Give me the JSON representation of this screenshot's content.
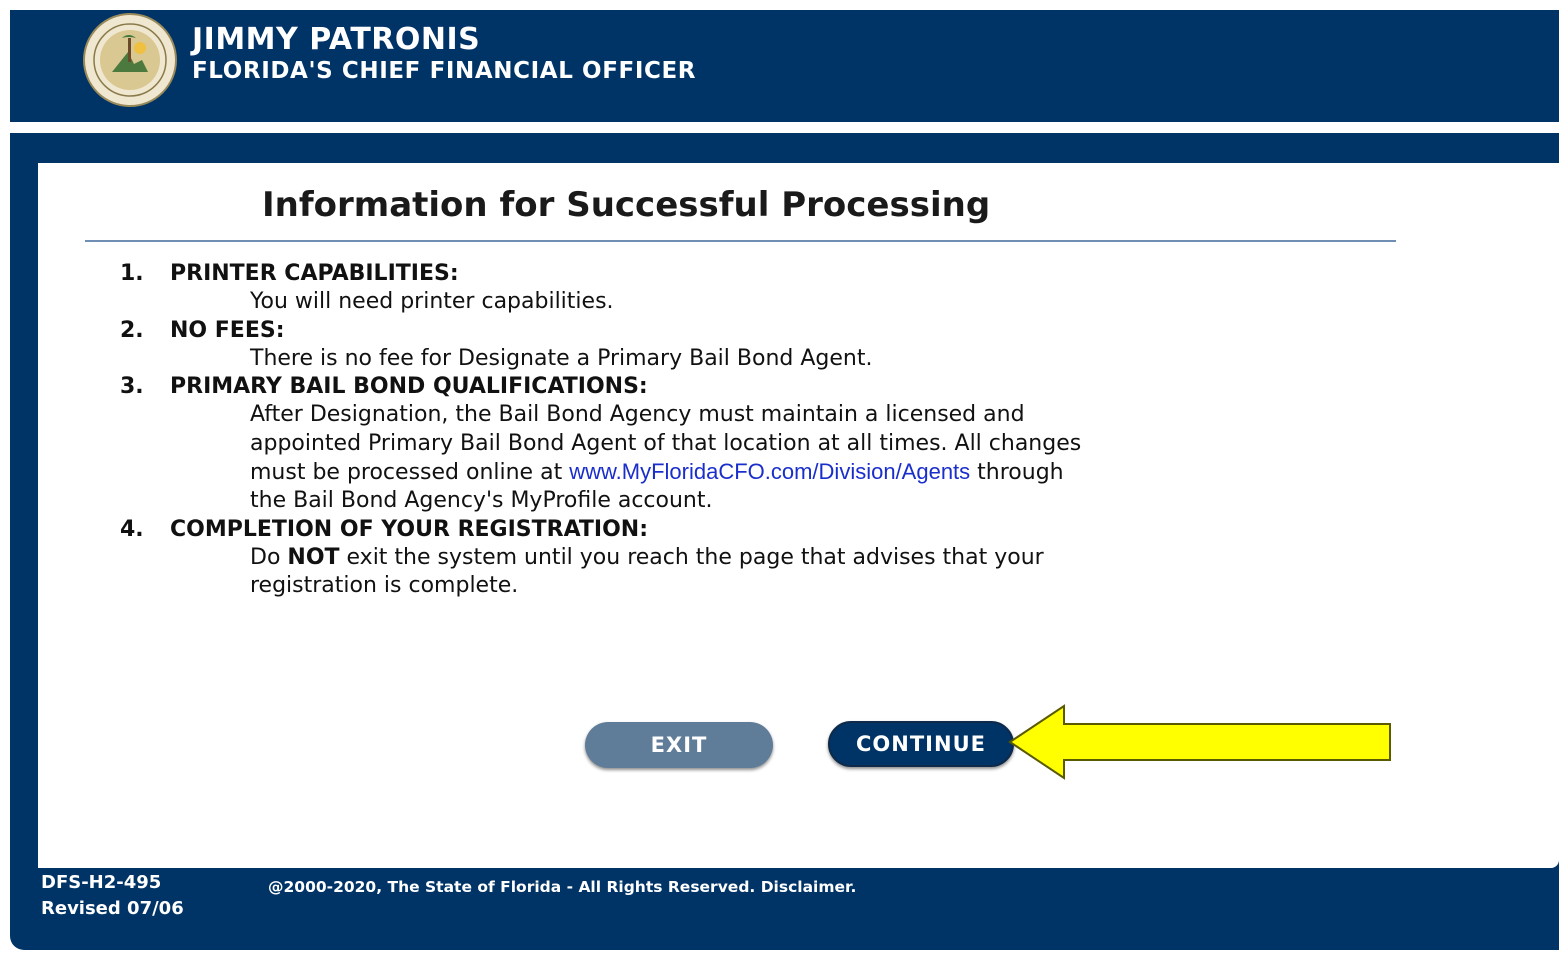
{
  "header": {
    "name": "JIMMY PATRONIS",
    "subtitle": "FLORIDA'S CHIEF FINANCIAL OFFICER",
    "seal_icon": "florida-cfo-seal-icon"
  },
  "main": {
    "title": "Information for Successful Processing",
    "items": [
      {
        "number": "1.",
        "heading": "PRINTER CAPABILITIES:",
        "body": "You will need printer capabilities."
      },
      {
        "number": "2.",
        "heading": "NO FEES:",
        "body": "There is no fee for Designate a Primary Bail Bond Agent."
      },
      {
        "number": "3.",
        "heading": "PRIMARY BAIL BOND QUALIFICATIONS:",
        "body_line1": "After Designation, the Bail Bond Agency must maintain a licensed and",
        "body_line2": "appointed Primary Bail Bond Agent of that location at all times. All changes",
        "body_line3_before": "must be processed online at ",
        "link": "www.MyFloridaCFO.com/Division/Agents",
        "body_line3_after": " through",
        "body_line4": "the Bail Bond Agency's MyProfile account."
      },
      {
        "number": "4.",
        "heading": "COMPLETION OF YOUR REGISTRATION:",
        "body_pre": "Do ",
        "body_strong": "NOT",
        "body_post": " exit the system until you reach the page that advises that your",
        "body_line2": "registration is complete."
      }
    ]
  },
  "buttons": {
    "exit_label": "EXIT",
    "continue_label": "CONTINUE"
  },
  "annotation": {
    "arrow_icon": "yellow-arrow-icon",
    "color": "#ffff00"
  },
  "footer": {
    "form_code": "DFS-H2-495",
    "revised": "Revised 07/06",
    "copyright": "@2000-2020, The State of Florida - All Rights Reserved. Disclaimer."
  },
  "colors": {
    "brand_navy": "#003366",
    "exit_button": "#5f7d99",
    "link": "#1a2ecc"
  }
}
